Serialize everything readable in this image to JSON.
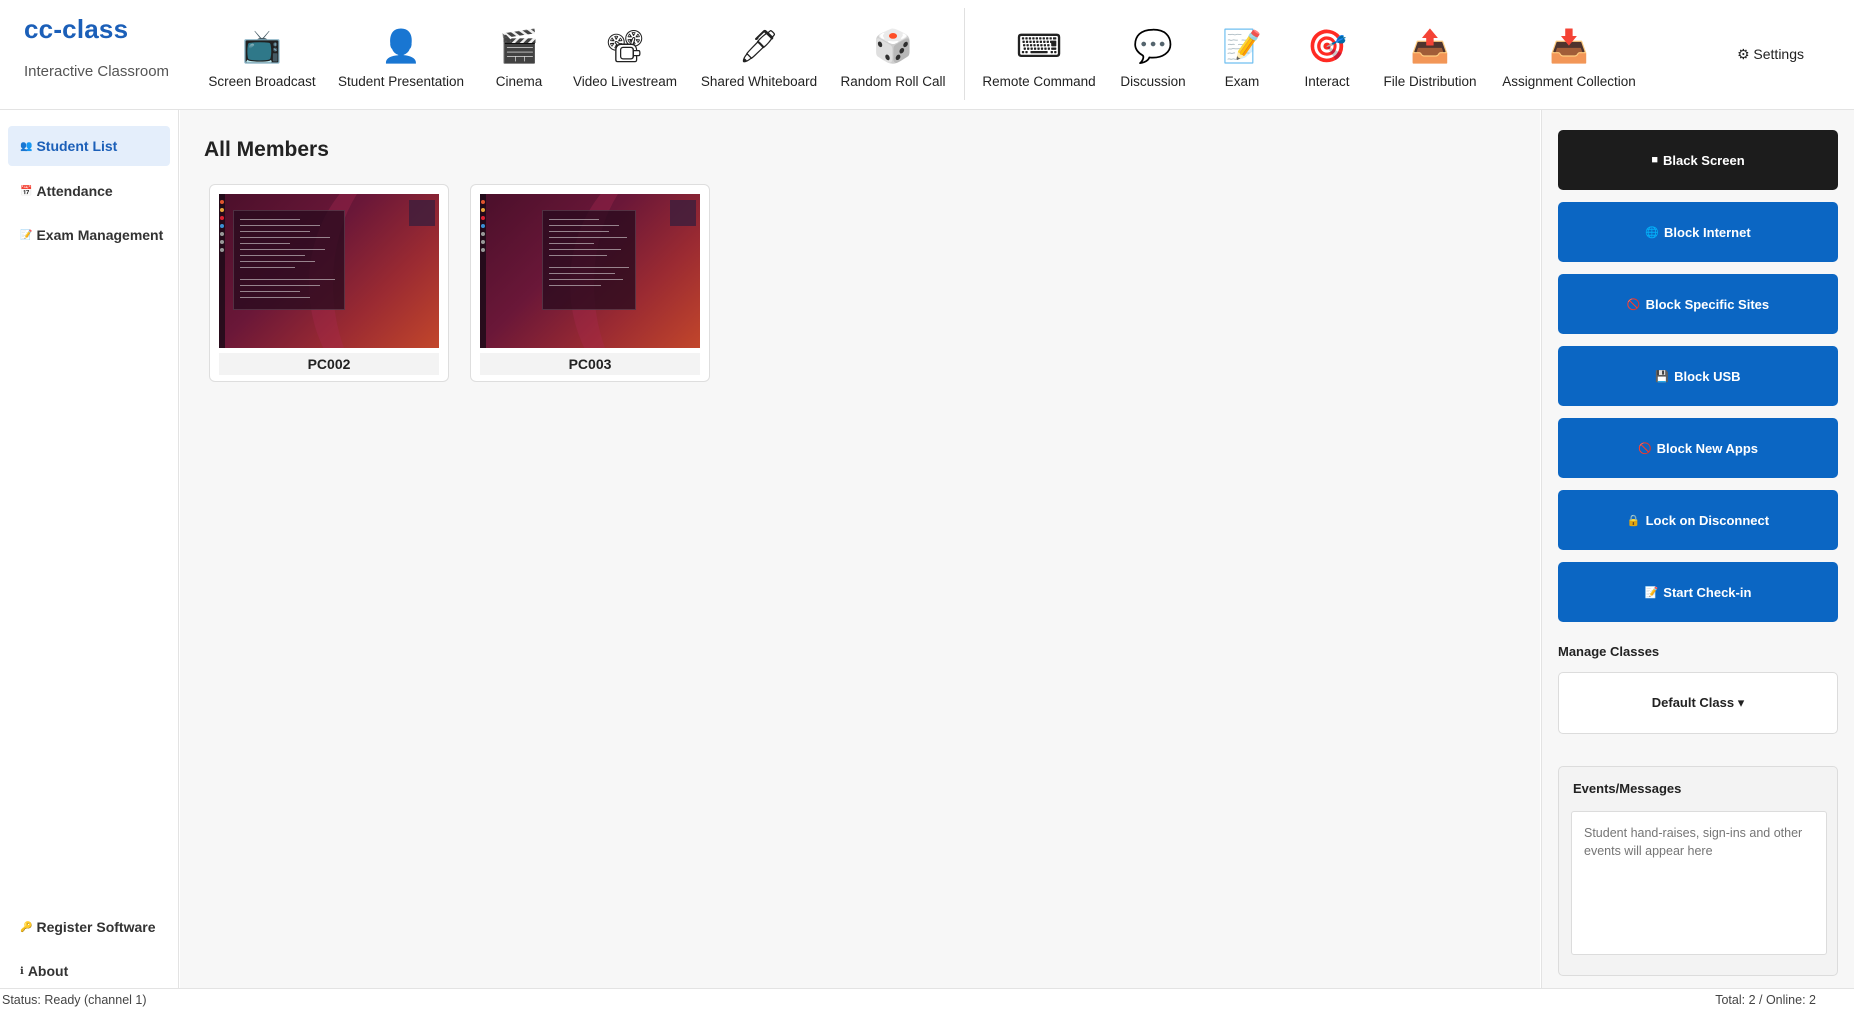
{
  "brand": {
    "title": "cc-class",
    "subtitle": "Interactive Classroom"
  },
  "toolbar": {
    "tools": [
      {
        "label": "Screen Broadcast",
        "icon": "tv-icon",
        "glyph": "📺"
      },
      {
        "label": "Student Presentation",
        "icon": "user-icon",
        "glyph": "👤"
      },
      {
        "label": "Cinema",
        "icon": "clapperboard-icon",
        "glyph": "🎬"
      },
      {
        "label": "Video Livestream",
        "icon": "film-projector-icon",
        "glyph": "📽"
      },
      {
        "label": "Shared Whiteboard",
        "icon": "pen-icon",
        "glyph": "🖊"
      },
      {
        "label": "Random Roll Call",
        "icon": "dice-icon",
        "glyph": "🎲"
      },
      {
        "label": "Remote Command",
        "icon": "keyboard-icon",
        "glyph": "⌨"
      },
      {
        "label": "Discussion",
        "icon": "speech-bubble-icon",
        "glyph": "💬"
      },
      {
        "label": "Exam",
        "icon": "memo-icon",
        "glyph": "📝"
      },
      {
        "label": "Interact",
        "icon": "target-icon",
        "glyph": "🎯"
      },
      {
        "label": "File Distribution",
        "icon": "outbox-tray-icon",
        "glyph": "📤"
      },
      {
        "label": "Assignment Collection",
        "icon": "inbox-tray-icon",
        "glyph": "📥"
      }
    ],
    "settings_label": "⚙ Settings"
  },
  "sidebar": {
    "items": [
      {
        "label": "Student List",
        "icon": "people-icon",
        "glyph": "👥",
        "active": true
      },
      {
        "label": "Attendance",
        "icon": "calendar-icon",
        "glyph": "📅",
        "active": false
      },
      {
        "label": "Exam Management",
        "icon": "memo-icon",
        "glyph": "📝",
        "active": false
      }
    ],
    "bottom_items": [
      {
        "label": "Register Software",
        "icon": "key-icon",
        "glyph": "🔑"
      },
      {
        "label": "About",
        "icon": "info-icon",
        "glyph": "ℹ"
      }
    ]
  },
  "main": {
    "title": "All Members",
    "members": [
      {
        "name": "PC002"
      },
      {
        "name": "PC003"
      }
    ]
  },
  "right_panel": {
    "buttons": [
      {
        "label": "Black Screen",
        "icon": "black-square-icon",
        "glyph": "■",
        "style": "dark"
      },
      {
        "label": "Block Internet",
        "icon": "globe-icon",
        "glyph": "🌐",
        "style": "blue"
      },
      {
        "label": "Block Specific Sites",
        "icon": "prohibited-icon",
        "glyph": "🚫",
        "style": "blue"
      },
      {
        "label": "Block USB",
        "icon": "floppy-disk-icon",
        "glyph": "💾",
        "style": "blue"
      },
      {
        "label": "Block New Apps",
        "icon": "prohibited-icon",
        "glyph": "🚫",
        "style": "blue"
      },
      {
        "label": "Lock on Disconnect",
        "icon": "lock-icon",
        "glyph": "🔒",
        "style": "blue"
      },
      {
        "label": "Start Check-in",
        "icon": "memo-icon",
        "glyph": "📝",
        "style": "blue"
      }
    ],
    "manage_classes_label": "Manage Classes",
    "class_select_value": "Default Class ▾",
    "events_title": "Events/Messages",
    "events_placeholder": "Student hand-raises, sign-ins and other events will appear here"
  },
  "status": {
    "left": "Status: Ready (channel 1)",
    "right": "Total: 2 / Online: 2"
  },
  "colors": {
    "brand": "#1b5fb8",
    "primary_button": "#0b66c3",
    "dark_button": "#1c1c1c",
    "active_nav_bg": "#e4eefb"
  }
}
